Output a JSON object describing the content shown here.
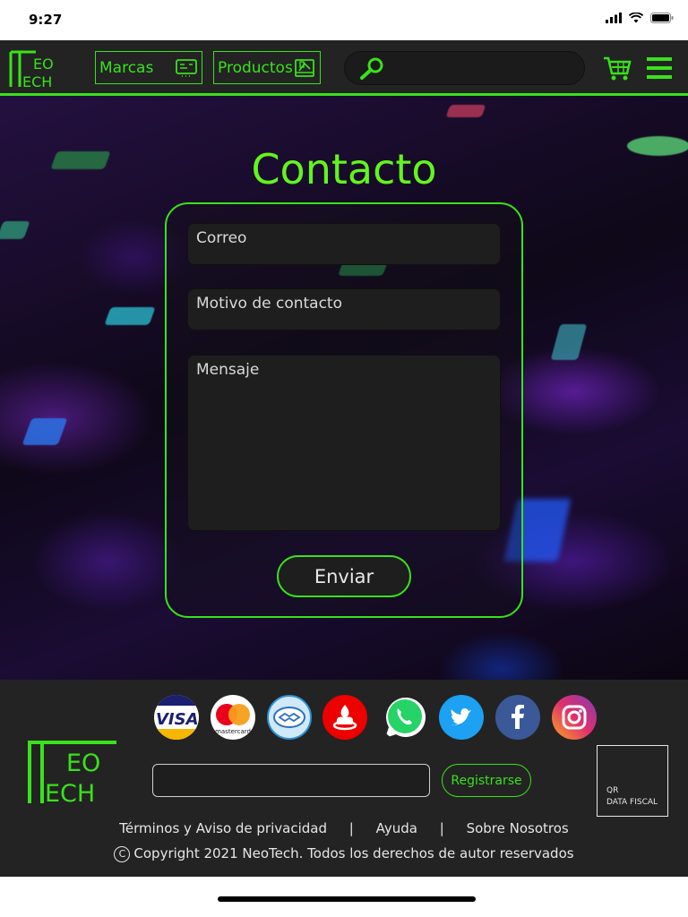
{
  "status": {
    "time": "9:27"
  },
  "header": {
    "logo_top": "EO",
    "logo_bottom": "ECH",
    "brands_label": "Marcas",
    "products_label": "Productos"
  },
  "contact": {
    "title": "Contacto",
    "email_placeholder": "Correo",
    "reason_placeholder": "Motivo de contacto",
    "message_placeholder": "Mensaje",
    "submit_label": "Enviar"
  },
  "footer": {
    "logo_top": "EO",
    "logo_bottom": "ECH",
    "payment_icons": [
      "visa-icon",
      "mastercard-icon",
      "mercadopago-icon",
      "santander-icon"
    ],
    "social_icons": [
      "whatsapp-icon",
      "twitter-icon",
      "facebook-icon",
      "instagram-icon"
    ],
    "mastercard_text": "mastercard",
    "register_label": "Registrarse",
    "qr_line1": "QR",
    "qr_line2": "DATA FISCAL",
    "link_terms": "Términos y Aviso de privacidad",
    "link_help": "Ayuda",
    "link_about": "Sobre Nosotros",
    "separator": "|",
    "copyright_symbol": "C",
    "copyright": "Copyright 2021 NeoTech. Todos los derechos de autor reservados"
  },
  "colors": {
    "accent": "#39e21b",
    "title": "#62f51c",
    "bar": "#232323"
  }
}
